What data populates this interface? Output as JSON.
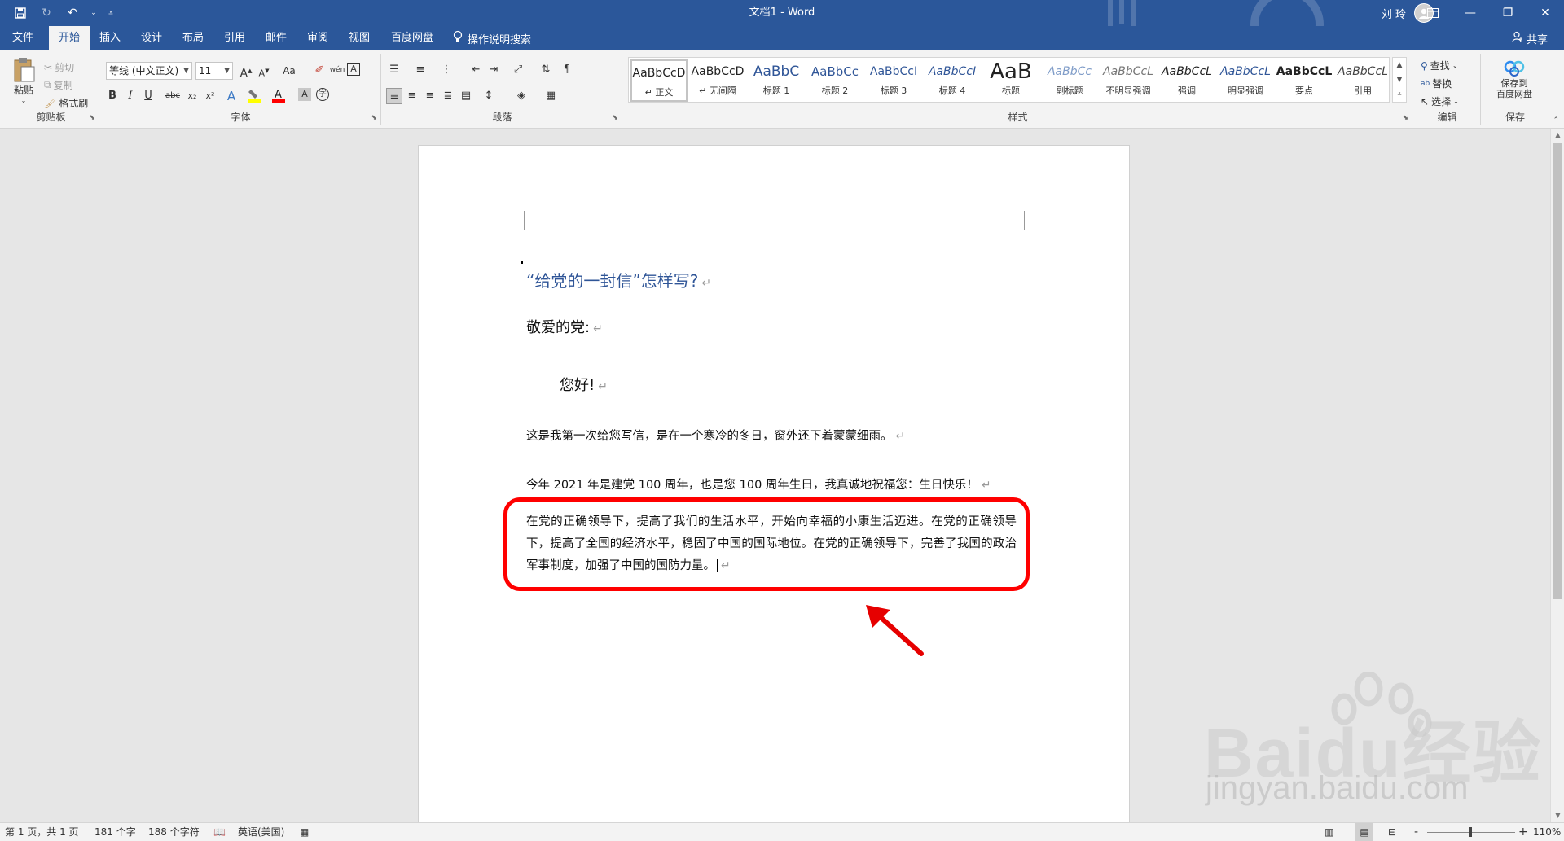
{
  "app": {
    "title": "文档1 - Word",
    "user_name": "刘 玲",
    "window_controls": [
      "ribbon-display-icon",
      "minimize-icon",
      "restore-icon",
      "close-icon"
    ]
  },
  "qat": {
    "icons": [
      "save-icon",
      "autosave-icon",
      "undo-icon",
      "undo-dropdown-icon",
      "customize-qat-icon"
    ]
  },
  "tabs": [
    {
      "label": "文件",
      "active": false
    },
    {
      "label": "开始",
      "active": true
    },
    {
      "label": "插入",
      "active": false
    },
    {
      "label": "设计",
      "active": false
    },
    {
      "label": "布局",
      "active": false
    },
    {
      "label": "引用",
      "active": false
    },
    {
      "label": "邮件",
      "active": false
    },
    {
      "label": "审阅",
      "active": false
    },
    {
      "label": "视图",
      "active": false
    },
    {
      "label": "百度网盘",
      "active": false
    }
  ],
  "tell_me": "操作说明搜索",
  "share": "共享",
  "ribbon": {
    "clipboard": {
      "label": "剪贴板",
      "paste": "粘贴",
      "cut": "剪切",
      "copy": "复制",
      "format_painter": "格式刷"
    },
    "font": {
      "label": "字体",
      "font_name": "等线 (中文正文)",
      "font_size": "11",
      "bold": "B",
      "italic": "I",
      "underline": "U",
      "strikethrough": "abc",
      "subscript": "x₂",
      "superscript": "x²",
      "grow": "A",
      "shrink": "A",
      "change_case": "Aa",
      "phonetic": "wén"
    },
    "paragraph": {
      "label": "段落"
    },
    "styles": {
      "label": "样式",
      "items": [
        {
          "sample": "AaBbCcD",
          "name": "正文",
          "selected": true
        },
        {
          "sample": "AaBbCcD",
          "name": "无间隔",
          "selected": false
        },
        {
          "sample": "AaBbC",
          "name": "标题 1",
          "selected": false
        },
        {
          "sample": "AaBbCc",
          "name": "标题 2",
          "selected": false
        },
        {
          "sample": "AaBbCcI",
          "name": "标题 3",
          "selected": false
        },
        {
          "sample": "AaBbCcI",
          "name": "标题 4",
          "selected": false
        },
        {
          "sample": "AaB",
          "name": "标题",
          "selected": false
        },
        {
          "sample": "AaBbCc",
          "name": "副标题",
          "selected": false
        },
        {
          "sample": "AaBbCcL",
          "name": "不明显强调",
          "selected": false
        },
        {
          "sample": "AaBbCcL",
          "name": "强调",
          "selected": false
        },
        {
          "sample": "AaBbCcL",
          "name": "明显强调",
          "selected": false
        },
        {
          "sample": "AaBbCcL",
          "name": "要点",
          "selected": false
        },
        {
          "sample": "AaBbCcL",
          "name": "引用",
          "selected": false
        }
      ]
    },
    "editing": {
      "label": "编辑",
      "find": "查找",
      "replace": "替换",
      "select": "选择"
    },
    "save": {
      "label": "保存",
      "button": "保存到\n百度网盘",
      "line1": "保存到",
      "line2": "百度网盘"
    }
  },
  "document": {
    "heading": "“给党的一封信”怎样写?",
    "salutation": "敬爱的党:",
    "greeting": "您好!",
    "para1": "这是我第一次给您写信，是在一个寒冷的冬日，窗外还下着蒙蒙细雨。",
    "para2": "今年 2021 年是建党 100 周年，也是您 100 周年生日，我真诚地祝福您：生日快乐！",
    "para3": "在党的正确领导下，提高了我们的生活水平，开始向幸福的小康生活迈进。在党的正确领导下，提高了全国的经济水平，稳固了中国的国际地位。在党的正确领导下，完善了我国的政治军事制度，加强了中国的国防力量。",
    "paragraph_mark": "↵"
  },
  "status": {
    "page": "第 1 页，共 1 页",
    "words": "181 个字",
    "chars": "188 个字符",
    "language": "英语(美国)",
    "zoom": "110%",
    "zoom_minus": "-",
    "zoom_plus": "+"
  },
  "watermark": {
    "brand": "Baidu经验",
    "url": "jingyan.baidu.com"
  },
  "colors": {
    "title_bar": "#2b579a",
    "heading": "#2f5597",
    "annotation": "#ff0000"
  }
}
